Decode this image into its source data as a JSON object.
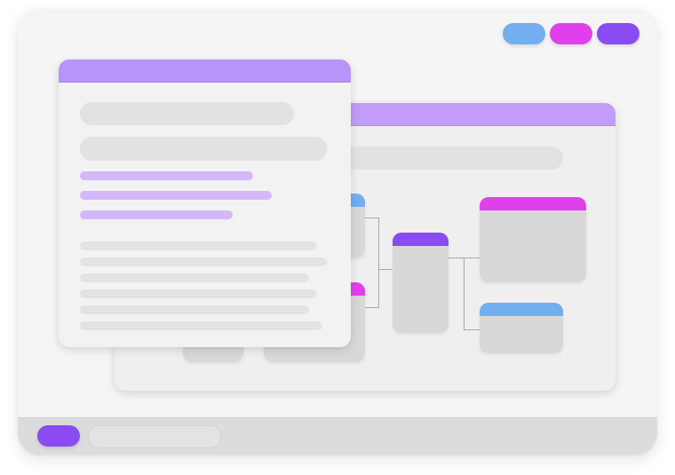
{
  "colors": {
    "accent_purple": "#a98ef8",
    "accent_violet": "#8b4bf2",
    "accent_magenta": "#e040ec",
    "accent_blue": "#72aef0",
    "placeholder_gray": "#e2e2e2",
    "text_line_purple": "#d3b8f9",
    "node_gray": "#d8d8d8"
  },
  "top_toolbar": {
    "buttons": [
      {
        "name": "blue-pill-button",
        "color": "#72aef0"
      },
      {
        "name": "magenta-pill-button",
        "color": "#e040ec"
      },
      {
        "name": "purple-pill-button",
        "color": "#8b4bf2"
      }
    ]
  },
  "diagram_window": {
    "title_bar_color": "#c19cf9",
    "nodes": [
      {
        "name": "node-blue-left",
        "header": "#72aef0"
      },
      {
        "name": "node-magenta-left",
        "header": "#e040ec"
      },
      {
        "name": "node-purple-center",
        "header": "#8b4bf2"
      },
      {
        "name": "node-magenta-right",
        "header": "#e040ec"
      },
      {
        "name": "node-blue-right",
        "header": "#72aef0"
      }
    ]
  },
  "document_window": {
    "title_bar_color": "#b994f8"
  },
  "dock": {
    "primary_button_color": "#8b4bf2",
    "search_placeholder": ""
  }
}
